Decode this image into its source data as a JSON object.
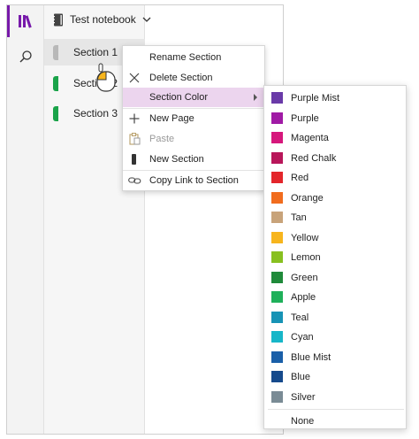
{
  "header": {
    "notebook_title": "Test notebook"
  },
  "sections": [
    {
      "label": "Section 1",
      "color": "#b8b8b8",
      "selected": true
    },
    {
      "label": "Section 2",
      "color": "#1aa34a",
      "selected": false
    },
    {
      "label": "Section 3",
      "color": "#1aa34a",
      "selected": false
    }
  ],
  "context_menu": {
    "items": [
      {
        "label": "Rename Section",
        "icon": "none"
      },
      {
        "label": "Delete Section",
        "icon": "close-icon"
      },
      {
        "label": "Section Color",
        "icon": "none"
      },
      {
        "label": "New Page",
        "icon": "plus-icon"
      },
      {
        "label": "Paste",
        "icon": "paste-icon"
      },
      {
        "label": "New Section",
        "icon": "new-section-icon"
      },
      {
        "label": "Copy Link to Section",
        "icon": "link-icon"
      }
    ]
  },
  "color_menu": {
    "items": [
      {
        "label": "Purple Mist",
        "color": "#6a3aa8"
      },
      {
        "label": "Purple",
        "color": "#a01aa5"
      },
      {
        "label": "Magenta",
        "color": "#d6177c"
      },
      {
        "label": "Red Chalk",
        "color": "#b8165a"
      },
      {
        "label": "Red",
        "color": "#e3262b"
      },
      {
        "label": "Orange",
        "color": "#f16c1e"
      },
      {
        "label": "Tan",
        "color": "#c8a37a"
      },
      {
        "label": "Yellow",
        "color": "#f7b51d"
      },
      {
        "label": "Lemon",
        "color": "#88c020"
      },
      {
        "label": "Green",
        "color": "#1f8a3a"
      },
      {
        "label": "Apple",
        "color": "#1fb05a"
      },
      {
        "label": "Teal",
        "color": "#1793b5"
      },
      {
        "label": "Cyan",
        "color": "#17b6c8"
      },
      {
        "label": "Blue Mist",
        "color": "#1a5fa8"
      },
      {
        "label": "Blue",
        "color": "#164a8c"
      },
      {
        "label": "Silver",
        "color": "#7a8b95"
      },
      {
        "label": "None",
        "color": ""
      }
    ]
  },
  "accent": "#7719aa"
}
